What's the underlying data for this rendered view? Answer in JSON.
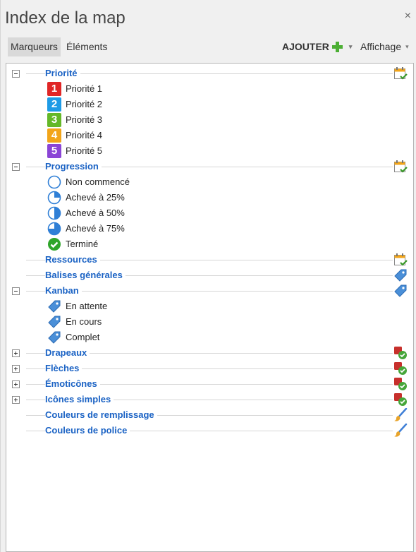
{
  "panel": {
    "title": "Index de la map",
    "close": "×"
  },
  "toolbar": {
    "tabs": [
      {
        "label": "Marqueurs",
        "active": true
      },
      {
        "label": "Éléments",
        "active": false
      }
    ],
    "add_label": "AJOUTER",
    "view_label": "Affichage",
    "caret": "▾"
  },
  "colors": {
    "heading": "#1a62c4",
    "plus": "#4caf34",
    "p1": "#e02626",
    "p2": "#1e9be6",
    "p3": "#64b828",
    "p4": "#f2a51a",
    "p5": "#8b45d6"
  },
  "tree": {
    "priorite": {
      "title": "Priorité",
      "expanded": true,
      "icon": "calendar-check-icon",
      "items": [
        {
          "num": "1",
          "label": "Priorité 1",
          "color": "#e02626"
        },
        {
          "num": "2",
          "label": "Priorité 2",
          "color": "#1e9be6"
        },
        {
          "num": "3",
          "label": "Priorité 3",
          "color": "#64b828"
        },
        {
          "num": "4",
          "label": "Priorité 4",
          "color": "#f2a51a"
        },
        {
          "num": "5",
          "label": "Priorité 5",
          "color": "#8b45d6"
        }
      ]
    },
    "progression": {
      "title": "Progression",
      "expanded": true,
      "icon": "calendar-check-icon",
      "items": [
        {
          "label": "Non commencé",
          "progress": 0
        },
        {
          "label": "Achevé à 25%",
          "progress": 0.25
        },
        {
          "label": "Achevé à 50%",
          "progress": 0.5
        },
        {
          "label": "Achevé à 75%",
          "progress": 0.75
        },
        {
          "label": "Terminé",
          "progress": 1
        }
      ]
    },
    "ressources": {
      "title": "Ressources",
      "icon": "calendar-check-icon"
    },
    "balises": {
      "title": "Balises générales",
      "icon": "tag-icon"
    },
    "kanban": {
      "title": "Kanban",
      "expanded": true,
      "icon": "tag-icon",
      "items": [
        {
          "label": "En attente"
        },
        {
          "label": "En cours"
        },
        {
          "label": "Complet"
        }
      ]
    },
    "drapeaux": {
      "title": "Drapeaux",
      "expanded": false,
      "icon": "marker-check-icon"
    },
    "fleches": {
      "title": "Flèches",
      "expanded": false,
      "icon": "marker-check-icon"
    },
    "emoticones": {
      "title": "Émoticônes",
      "expanded": false,
      "icon": "marker-check-icon"
    },
    "icones": {
      "title": "Icônes simples",
      "expanded": false,
      "icon": "marker-check-icon"
    },
    "remplissage": {
      "title": "Couleurs de remplissage",
      "icon": "paintbrush-icon"
    },
    "police": {
      "title": "Couleurs de police",
      "icon": "paintbrush-icon"
    }
  }
}
